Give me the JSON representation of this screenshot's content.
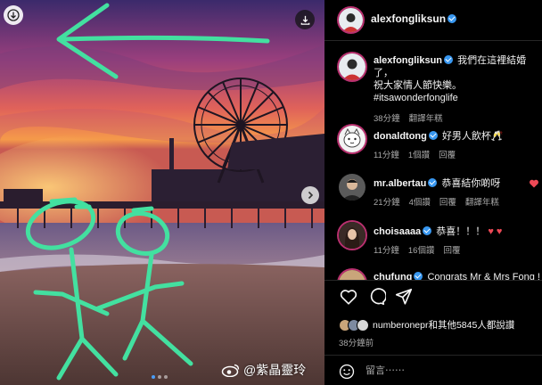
{
  "post": {
    "author": "alexfongliksun",
    "caption_line1": "我們在這裡結婚了，",
    "caption_line2": "祝大家情人節快樂。",
    "hashtag": "#itsawonderfonglife",
    "caption_time": "38分鐘",
    "caption_action": "翻譯年糕"
  },
  "comments": [
    {
      "user": "donaldtong",
      "text": "好男人飲杯🥂",
      "time": "11分鐘",
      "likes": "1個讚",
      "reply": "回覆"
    },
    {
      "user": "mr.albertau",
      "text": "恭喜結你啲呀",
      "time": "21分鐘",
      "likes": "4個讚",
      "reply": "回覆",
      "translate": "翻譯年糕"
    },
    {
      "user": "choisaaaa",
      "text": "恭喜！！！",
      "time": "11分鐘",
      "likes": "16個讚",
      "reply": "回覆"
    },
    {
      "user": "chufung",
      "text": "Congrats Mr & Mrs Fong !"
    }
  ],
  "likes_text": "numberonepr和其他5845人都說讚",
  "posted_ago": "38分鐘前",
  "comment_input": {
    "placeholder": "留言⋯⋯"
  },
  "watermark": "@紫晶靈玲",
  "carousel": {
    "count": 3,
    "active": 1
  },
  "colors": {
    "verified": "#3897f0",
    "like_red": "#ed4956",
    "scribble": "#43e0a0"
  },
  "icons": [
    "download-icon",
    "chevron-right-icon",
    "heart-icon",
    "comment-icon",
    "share-icon",
    "emoji-icon",
    "weibo-icon"
  ]
}
